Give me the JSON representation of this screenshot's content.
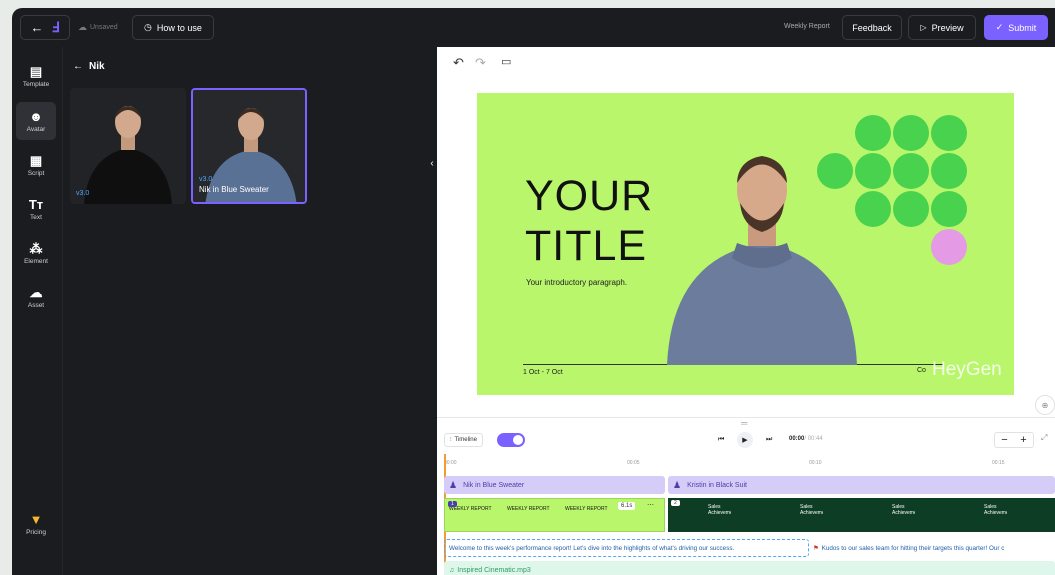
{
  "topbar": {
    "save_status": "Unsaved",
    "how_to_use": "How to use",
    "project_name": "Weekly Report",
    "feedback": "Feedback",
    "preview": "Preview",
    "submit": "Submit"
  },
  "colors": {
    "accent": "#7b61ff",
    "slide_bg": "#b9f66b",
    "dot_green": "#48d24d",
    "dot_pink": "#e59ae6"
  },
  "sidebar": {
    "items": [
      {
        "label": "Template",
        "icon": "template-icon"
      },
      {
        "label": "Avatar",
        "icon": "avatar-icon"
      },
      {
        "label": "Script",
        "icon": "script-icon"
      },
      {
        "label": "Text",
        "icon": "text-icon",
        "glyph": "Tт"
      },
      {
        "label": "Element",
        "icon": "element-icon"
      },
      {
        "label": "Asset",
        "icon": "upload-icon"
      }
    ],
    "pricing": "Pricing"
  },
  "panel": {
    "back_label": "Nik",
    "avatars": [
      {
        "version": "v3.0",
        "name": ""
      },
      {
        "version": "v3.0",
        "name": "Nik in Blue Sweater"
      }
    ]
  },
  "slide": {
    "title_line1": "YOUR",
    "title_line2": "TITLE",
    "paragraph": "Your introductory paragraph.",
    "date": "1 Oct - 7 Oct",
    "watermark": "HeyGen",
    "corner_text": "Co"
  },
  "timeline": {
    "label": "Timeline",
    "current": "00:00",
    "total": "/ 00:44",
    "ticks": [
      "00:00",
      "00:05",
      "00:10",
      "00:15"
    ],
    "avatar_tracks": [
      "Nik in Blue Sweater",
      "Kristin in Black Suit"
    ],
    "scene_numbers": [
      "1",
      "2"
    ],
    "duration_badge": "6.1s",
    "thumb_report": "WEEKLY REPORT",
    "thumb_sales": "Sales Achievement",
    "script_1": "Welcome to this week's performance report! Let's dive into the highlights of what's driving our success.",
    "script_2": "Kudos to our sales team for hitting their targets this quarter! Our c",
    "audio": "Inspired Cinematic.mp3"
  }
}
